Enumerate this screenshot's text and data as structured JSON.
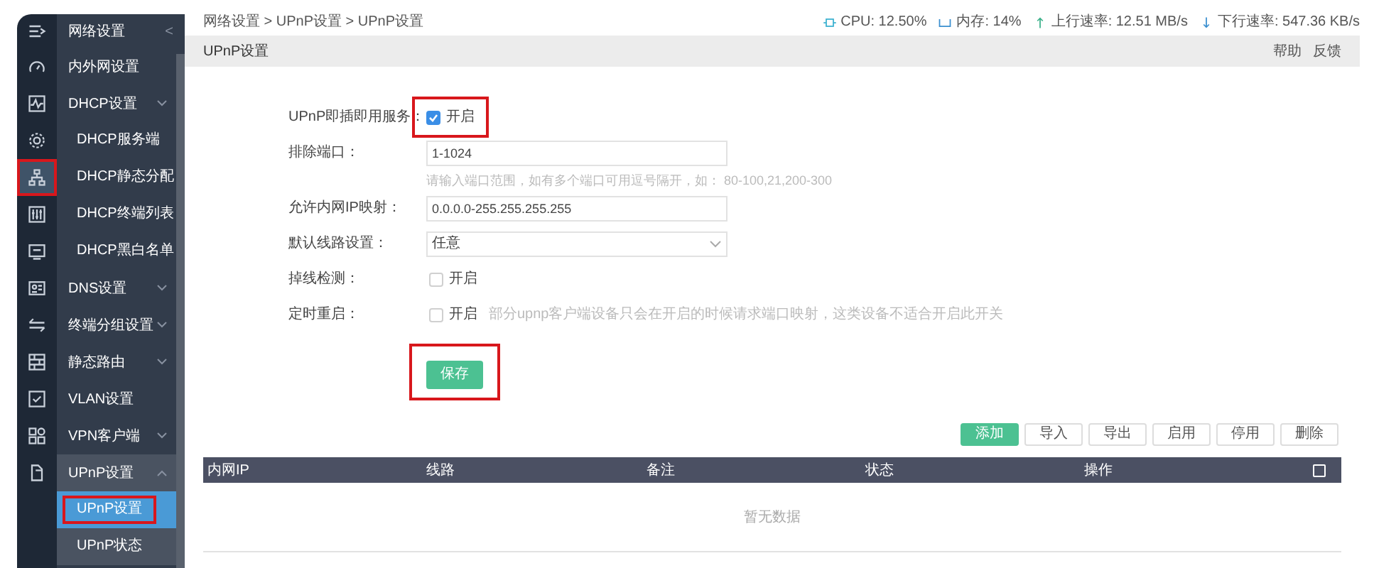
{
  "rail": [
    {
      "selected": false
    },
    {
      "selected": false
    },
    {
      "selected": false
    },
    {
      "selected": false
    },
    {
      "selected": true
    },
    {
      "selected": false
    },
    {
      "selected": false
    },
    {
      "selected": false
    },
    {
      "selected": false
    },
    {
      "selected": false
    },
    {
      "selected": false
    },
    {
      "selected": false
    },
    {
      "selected": false
    }
  ],
  "menu": {
    "title": "网络设置",
    "collapse": "<",
    "items": [
      {
        "label": "内外网设置",
        "kind": "item"
      },
      {
        "label": "DHCP设置",
        "kind": "group",
        "expanded": false,
        "children": [
          {
            "label": "DHCP服务端",
            "selected": false
          },
          {
            "label": "DHCP静态分配",
            "selected": false
          },
          {
            "label": "DHCP终端列表",
            "selected": false
          },
          {
            "label": "DHCP黑白名单",
            "selected": false
          }
        ]
      },
      {
        "label": "DNS设置",
        "kind": "group",
        "expanded": false
      },
      {
        "label": "终端分组设置",
        "kind": "group",
        "expanded": false
      },
      {
        "label": "静态路由",
        "kind": "group",
        "expanded": false
      },
      {
        "label": "VLAN设置",
        "kind": "item"
      },
      {
        "label": "VPN客户端",
        "kind": "group",
        "expanded": false
      },
      {
        "label": "UPnP设置",
        "kind": "group",
        "expanded": true,
        "children": [
          {
            "label": "UPnP设置",
            "selected": true
          },
          {
            "label": "UPnP状态",
            "selected": false
          }
        ]
      }
    ]
  },
  "breadcrumb": "网络设置 > UPnP设置 > UPnP设置",
  "status": [
    {
      "kind": "cpu",
      "text": "CPU: 12.50%"
    },
    {
      "kind": "memory",
      "text": "内存: 14%"
    },
    {
      "kind": "upload",
      "text": "上行速率: 12.51 MB/s"
    },
    {
      "kind": "download",
      "text": "下行速率: 547.36 KB/s"
    }
  ],
  "page": {
    "title": "UPnP设置",
    "links": [
      "帮助",
      "反馈"
    ]
  },
  "form": [
    {
      "kind": "checkbox",
      "label": "UPnP即插即用服务：",
      "checked": true,
      "text": "开启"
    },
    {
      "kind": "input",
      "label": "排除端口：",
      "value": "1-1024",
      "hint": "请输入端口范围，如有多个端口可用逗号隔开，如： 80-100,21,200-300"
    },
    {
      "kind": "input",
      "label": "允许内网IP映射：",
      "value": "0.0.0.0-255.255.255.255"
    },
    {
      "kind": "select",
      "label": "默认线路设置：",
      "value": "任意"
    },
    {
      "kind": "checkbox",
      "label": "掉线检测：",
      "checked": false,
      "text": "开启"
    },
    {
      "kind": "checkbox",
      "label": "定时重启：",
      "checked": false,
      "text": "开启",
      "note": "部分upnp客户端设备只会在开启的时候请求端口映射，这类设备不适合开启此开关"
    }
  ],
  "save": "保存",
  "toolbar": [
    {
      "label": "添加",
      "kind": "primary"
    },
    {
      "label": "导入",
      "kind": "default"
    },
    {
      "label": "导出",
      "kind": "default"
    },
    {
      "label": "启用",
      "kind": "default"
    },
    {
      "label": "停用",
      "kind": "default"
    },
    {
      "label": "删除",
      "kind": "default"
    }
  ],
  "table": {
    "columns": [
      "内网IP",
      "线路",
      "备注",
      "状态",
      "操作"
    ],
    "select_all": false,
    "empty": "暂无数据"
  }
}
